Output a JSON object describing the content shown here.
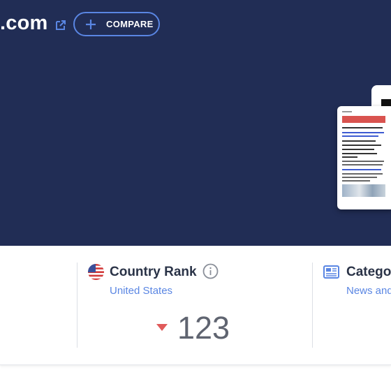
{
  "header": {
    "domain": ".com",
    "compare_label": "COMPARE"
  },
  "icons": {
    "external_link": "external-link-icon",
    "plus": "plus-icon",
    "flag": "us-flag-icon",
    "info": "info-icon",
    "category": "news-icon",
    "rank_change": "triangle-down-icon"
  },
  "colors": {
    "hero_background": "#212d55",
    "accent": "#5a86e3",
    "rank_down": "#e05a5a"
  },
  "country_rank": {
    "title": "Country Rank",
    "country": "United States",
    "value": "123"
  },
  "category": {
    "title": "Catego",
    "subtitle": "News and"
  }
}
